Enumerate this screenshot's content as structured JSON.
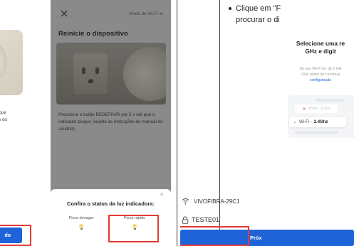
{
  "left": {
    "step_a": {
      "description": "até que\nções do",
      "next_button": "do",
      "link": "sso"
    },
    "step_b": {
      "mode_label": "Modo de Wi-Fi",
      "title": "Reinicie o dispositivo",
      "instructions": "Pressione o botão REDEFINIR por 5 s até que o indicador pisque (sujeito às instruções do manual do usuário).",
      "sheet": {
        "title": "Confira o status da luz indicadora:",
        "options": [
          {
            "label": "Pisca devagar"
          },
          {
            "label": "Pisca rápido",
            "highlighted": true
          }
        ]
      }
    }
  },
  "right": {
    "bullet": {
      "line1": "Clique em \"F",
      "line2": "procurar o di"
    },
    "step_c": {
      "heading_line1": "Selecione uma re",
      "heading_line2": "GHz e digit",
      "note_line1": "Se seu Wi-Fi for de 5 GH",
      "note_line2": "GHz antes de continua",
      "note_link": "configuração",
      "wifi_bad": "Wi-Fi - 5Ghz",
      "wifi_good_prefix": "Wi-Fi - ",
      "wifi_good_band": "2.4Ghz"
    },
    "ssid": "VIVOFIBRA-29C1",
    "password": "TESTE01",
    "next_button": "Próx"
  },
  "colors": {
    "primary": "#1f63d8",
    "highlight": "#e53935",
    "success": "#22b07a",
    "overlay": "#8a8a8a"
  },
  "icons": {
    "close": "close-icon",
    "swap": "swap-icon",
    "wifi": "wifi-icon",
    "lock": "lock-icon",
    "bulb": "bulb-icon",
    "check": "check-icon",
    "x": "x-icon"
  }
}
